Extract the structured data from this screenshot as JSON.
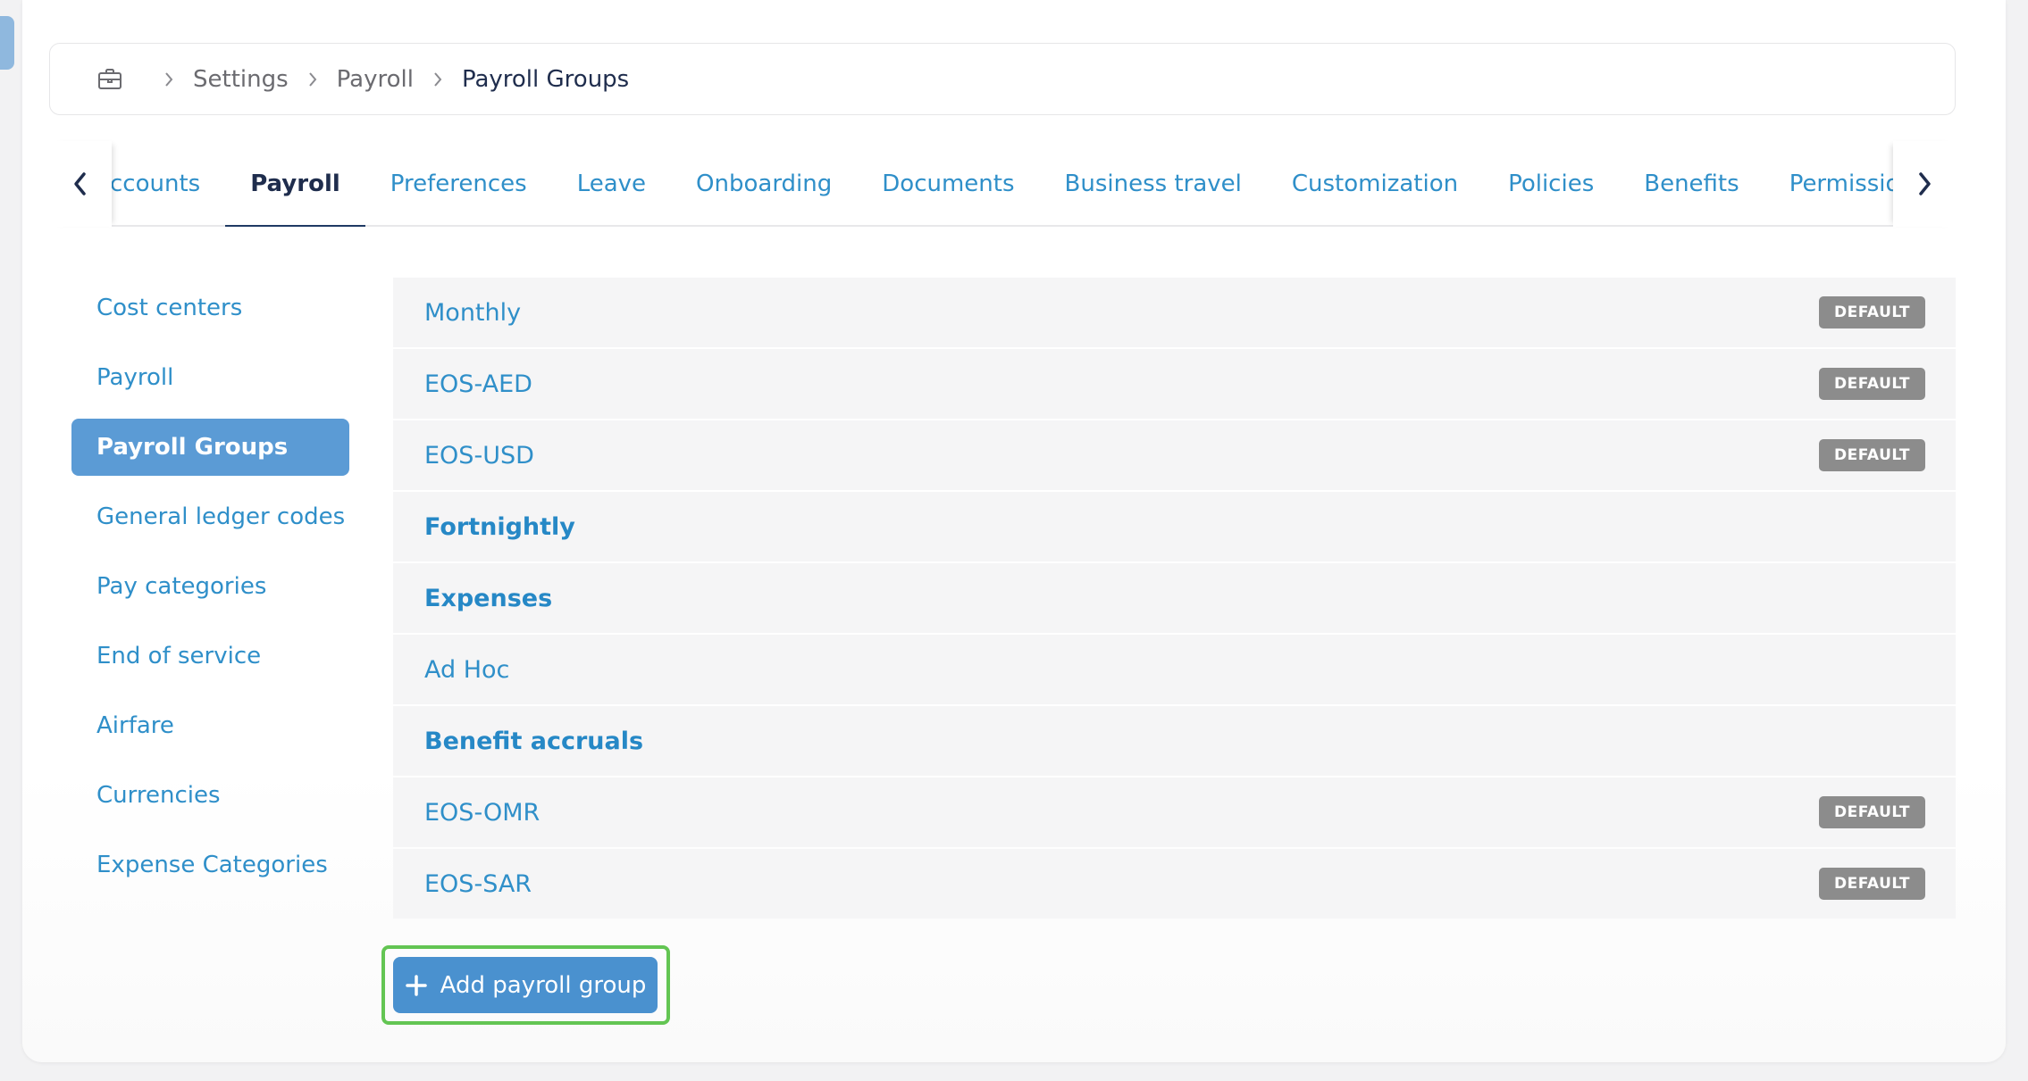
{
  "breadcrumb": {
    "home_icon": "briefcase-icon",
    "items": [
      "Settings",
      "Payroll",
      "Payroll Groups"
    ]
  },
  "tabs": {
    "items": [
      "ccounts",
      "Payroll",
      "Preferences",
      "Leave",
      "Onboarding",
      "Documents",
      "Business travel",
      "Customization",
      "Policies",
      "Benefits",
      "Permissions"
    ],
    "active": "Payroll",
    "prev_icon": "chevron-left-icon",
    "next_icon": "chevron-right-icon"
  },
  "side_menu": {
    "items": [
      "Cost centers",
      "Payroll",
      "Payroll Groups",
      "General ledger codes",
      "Pay categories",
      "End of service",
      "Airfare",
      "Currencies",
      "Expense Categories"
    ],
    "active": "Payroll Groups"
  },
  "payroll_groups": [
    {
      "name": "Monthly",
      "badge": "DEFAULT"
    },
    {
      "name": "EOS-AED",
      "badge": "DEFAULT"
    },
    {
      "name": "EOS-USD",
      "badge": "DEFAULT"
    },
    {
      "name": "Fortnightly",
      "badge": ""
    },
    {
      "name": "Expenses",
      "badge": ""
    },
    {
      "name": "Ad Hoc",
      "badge": ""
    },
    {
      "name": "Benefit accruals",
      "badge": ""
    },
    {
      "name": "EOS-OMR",
      "badge": "DEFAULT"
    },
    {
      "name": "EOS-SAR",
      "badge": "DEFAULT"
    }
  ],
  "add_button": {
    "label": "Add payroll group",
    "icon": "plus-icon"
  },
  "colors": {
    "link_blue": "#2f8fc9",
    "active_menu_bg": "#5b9bd5",
    "button_bg": "#4a91cf",
    "badge_bg": "#8c8c8c",
    "highlight_green": "#63c553",
    "dark_navy": "#1f2d4d"
  }
}
